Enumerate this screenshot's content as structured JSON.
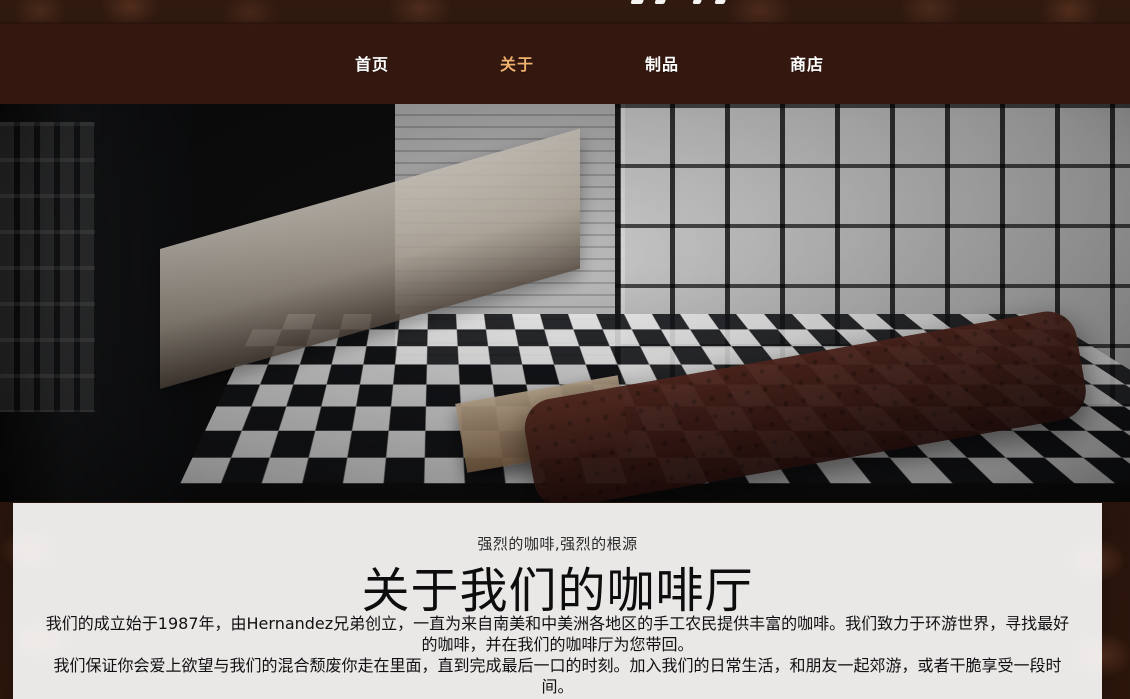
{
  "nav": {
    "items": [
      {
        "label": "首页",
        "active": false
      },
      {
        "label": "关于",
        "active": true
      },
      {
        "label": "制品",
        "active": false
      },
      {
        "label": "商店",
        "active": false
      }
    ]
  },
  "about": {
    "subtitle": "强烈的咖啡,强烈的根源",
    "title": "关于我们的咖啡厅",
    "paragraph_1": "我们的成立始于1987年，由Hernandez兄弟创立，一直为来自南美和中美洲各地区的手工农民提供丰富的咖啡。我们致力于环游世界，寻找最好的咖啡，并在我们的咖啡厅为您带回。",
    "paragraph_2": "我们保证你会爱上欲望与我们的混合颓废你走在里面，直到完成最后一口的时刻。加入我们的日常生活，和朋友一起郊游，或者干脆享受一段时间。"
  },
  "colors": {
    "nav_bg": "#341810",
    "nav_text": "#ffffff",
    "nav_active": "#f0b16c",
    "panel_bg": "#ffffff"
  }
}
